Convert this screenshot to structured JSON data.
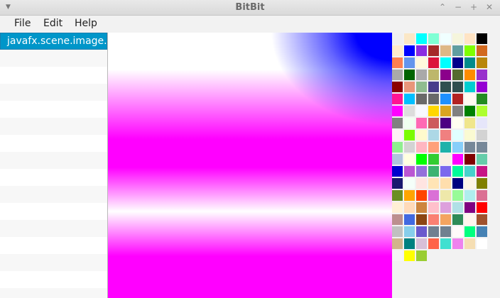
{
  "window": {
    "title": "BitBit"
  },
  "menubar": {
    "items": [
      "File",
      "Edit",
      "Help"
    ]
  },
  "list": {
    "selected_item": "javafx.scene.image.Image"
  },
  "palette": {
    "rows": [
      [
        "#f0f0f0",
        "#fbe7c6",
        "#00ffff",
        "#7fffd4",
        "#f0ffff",
        "#f5f5dc",
        "#ffe4c4",
        "#000000"
      ],
      [
        "#ffebcd",
        "#0000ff",
        "#8a2be2",
        "#a52a2a",
        "#deb887",
        "#5f9ea0",
        "#7fff00",
        "#d2691e"
      ],
      [
        "#ff7f50",
        "#6495ed",
        "#fff8dc",
        "#dc143c",
        "#00ffff",
        "#00008b",
        "#008b8b",
        "#b8860b"
      ],
      [
        "#a9a9a9",
        "#006400",
        "#a9a9a9",
        "#bdb76b",
        "#8b008b",
        "#556b2f",
        "#ff8c00",
        "#9932cc"
      ],
      [
        "#8b0000",
        "#e9967a",
        "#8fbc8f",
        "#483d8b",
        "#2f4f4f",
        "#2f4f4f",
        "#00ced1",
        "#9400d3"
      ],
      [
        "#ff1493",
        "#00bfff",
        "#696969",
        "#696969",
        "#1e90ff",
        "#b22222",
        "#fffaf0",
        "#228b22"
      ],
      [
        "#ff00ff",
        "#dcdcdc",
        "#f8f8ff",
        "#ffd700",
        "#daa520",
        "#808080",
        "#008000",
        "#adff2f"
      ],
      [
        "#808080",
        "#f0fff0",
        "#ff69b4",
        "#cd5c5c",
        "#4b0082",
        "#fffff0",
        "#f0e68c",
        "#e6e6fa"
      ],
      [
        "#fff0f5",
        "#7cfc00",
        "#fffacd",
        "#add8e6",
        "#f08080",
        "#e0ffff",
        "#fafad2",
        "#d3d3d3"
      ],
      [
        "#90ee90",
        "#d3d3d3",
        "#ffb6c1",
        "#ffa07a",
        "#20b2aa",
        "#87cefa",
        "#778899",
        "#778899"
      ],
      [
        "#b0c4de",
        "#ffffe0",
        "#00ff00",
        "#32cd32",
        "#faf0e6",
        "#ff00ff",
        "#800000",
        "#66cdaa"
      ],
      [
        "#0000cd",
        "#ba55d3",
        "#9370db",
        "#3cb371",
        "#7b68ee",
        "#00fa9a",
        "#48d1cc",
        "#c71585"
      ],
      [
        "#191970",
        "#f5fffa",
        "#ffe4e1",
        "#ffe4b5",
        "#ffdead",
        "#000080",
        "#fdf5e6",
        "#808000"
      ],
      [
        "#6b8e23",
        "#ffa500",
        "#ff4500",
        "#da70d6",
        "#eee8aa",
        "#98fb98",
        "#afeeee",
        "#db7093"
      ],
      [
        "#ffefd5",
        "#ffdab9",
        "#cd853f",
        "#ffc0cb",
        "#dda0dd",
        "#b0e0e6",
        "#800080",
        "#ff0000"
      ],
      [
        "#bc8f8f",
        "#4169e1",
        "#8b4513",
        "#fa8072",
        "#f4a460",
        "#2e8b57",
        "#fff5ee",
        "#a0522d"
      ],
      [
        "#c0c0c0",
        "#87ceeb",
        "#6a5acd",
        "#708090",
        "#708090",
        "#fffafa",
        "#00ff7f",
        "#4682b4"
      ],
      [
        "#d2b48c",
        "#008080",
        "#d8bfd8",
        "#ff6347",
        "#40e0d0",
        "#ee82ee",
        "#f5deb3",
        "#ffffff"
      ],
      [
        "#f5f5f5",
        "#ffff00",
        "#9acd32"
      ]
    ]
  }
}
